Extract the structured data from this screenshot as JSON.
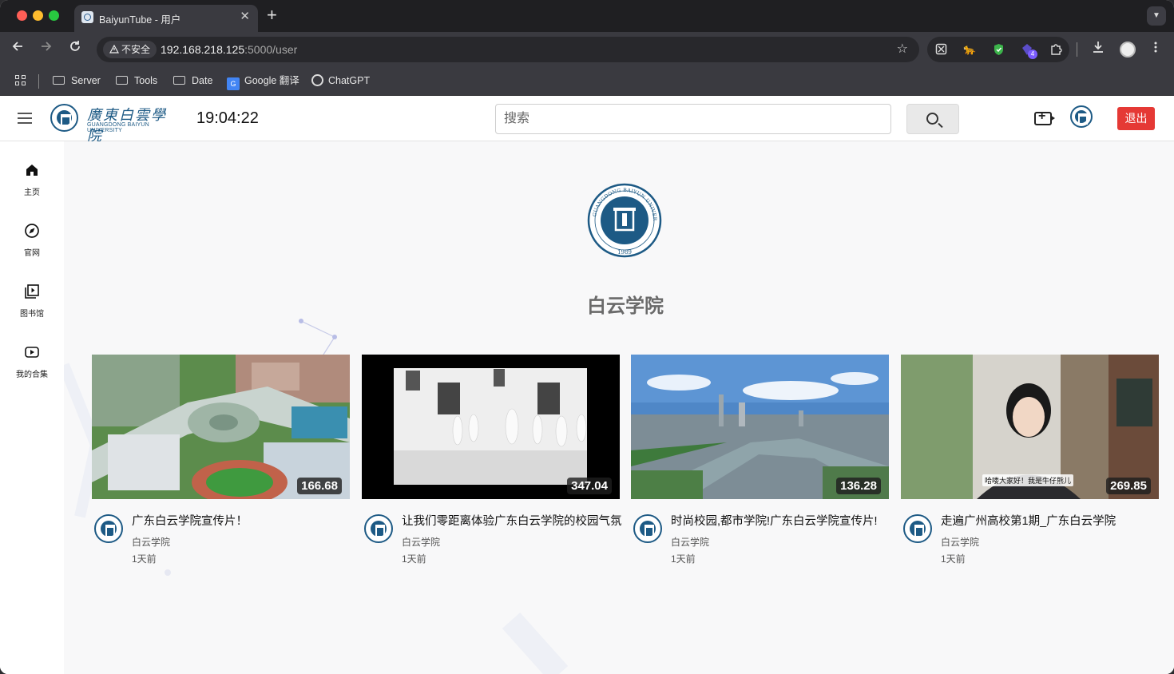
{
  "browser": {
    "tab_title": "BaiyunTube - 用户",
    "tab_close": "✕",
    "new_tab": "+",
    "security_label": "不安全",
    "url_host": "192.168.218.125",
    "url_rest": ":5000/user",
    "extension_badge": "4",
    "bookmarks": [
      {
        "label": "Server",
        "icon": "folder-icon"
      },
      {
        "label": "Tools",
        "icon": "folder-icon"
      },
      {
        "label": "Date",
        "icon": "folder-icon"
      },
      {
        "label": "Google 翻译",
        "icon": "google-translate-icon"
      },
      {
        "label": "ChatGPT",
        "icon": "chatgpt-icon"
      }
    ]
  },
  "header": {
    "logo_cn": "廣東白雲學院",
    "logo_en": "GUANGDONG BAIYUN UNIVERSITY",
    "clock": "19:04:22",
    "search_placeholder": "搜索",
    "logout_label": "退出"
  },
  "sidebar": {
    "items": [
      {
        "label": "主页",
        "icon": "home-icon"
      },
      {
        "label": "官网",
        "icon": "compass-icon"
      },
      {
        "label": "图书馆",
        "icon": "video-library-icon"
      },
      {
        "label": "我的合集",
        "icon": "youtube-play-icon"
      }
    ]
  },
  "channel": {
    "name": "白云学院",
    "seal_text": "GUANGDONG BAIYUN UNIVERSITY",
    "seal_year": "1989"
  },
  "videos": [
    {
      "title": "广东白云学院宣传片！",
      "channel": "白云学院",
      "time": "1天前",
      "duration": "166.68"
    },
    {
      "title": "让我们零距离体验广东白云学院的校园气氛",
      "channel": "白云学院",
      "time": "1天前",
      "duration": "347.04"
    },
    {
      "title": "时尚校园,都市学院!广东白云学院宣传片!",
      "channel": "白云学院",
      "time": "1天前",
      "duration": "136.28"
    },
    {
      "title": "走遍广州高校第1期_广东白云学院",
      "channel": "白云学院",
      "time": "1天前",
      "duration": "269.85"
    }
  ],
  "thumbnail_captions": {
    "video4_subtitle": "哈喽大家好！我是牛仔熊儿"
  },
  "colors": {
    "accent_red": "#e53935",
    "brand_blue": "#1d5a85",
    "browser_chrome": "#3a3a40"
  }
}
